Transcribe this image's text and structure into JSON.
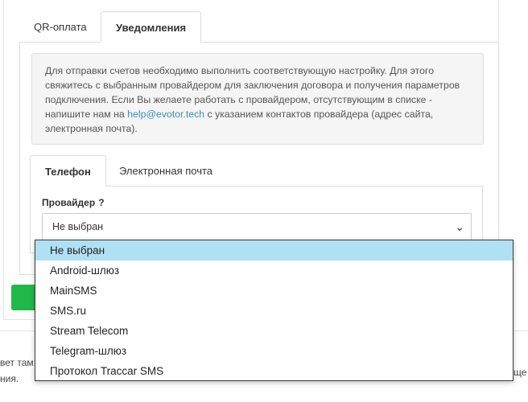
{
  "tabs_top": [
    {
      "label": "QR-оплата",
      "active": false
    },
    {
      "label": "Уведомления",
      "active": true
    }
  ],
  "notice": {
    "text_before": "Для отправки счетов необходимо выполнить соответствующую настройку. Для этого свяжитесь с выбранным провайдером для заключения договора и получения параметров подключения. Если Вы желаете работать с провайдером, отсутствующим в списке - напишите нам на ",
    "email": "help@evotor.tech",
    "text_after": " с указанием контактов провайдера (адрес сайта, электронная почта)."
  },
  "tabs_inner": [
    {
      "label": "Телефон",
      "active": true
    },
    {
      "label": "Электронная почта",
      "active": false
    }
  ],
  "provider": {
    "label": "Провайдер",
    "help": "?",
    "selected": "Не выбран",
    "chevron": "chevron-down-icon"
  },
  "dropdown_options": [
    "Не выбран",
    "Android-шлюз",
    "MainSMS",
    "SMS.ru",
    "Stream Telecom",
    "Telegram-шлюз",
    "Протокол Traccar SMS"
  ],
  "footer": {
    "line1": "вет там:",
    "line2": "ния.",
    "line3": "ще"
  },
  "colors": {
    "accent_link": "#3c8dbc",
    "selected_option": "#b0e0f3",
    "save_button": "#21b84a"
  }
}
